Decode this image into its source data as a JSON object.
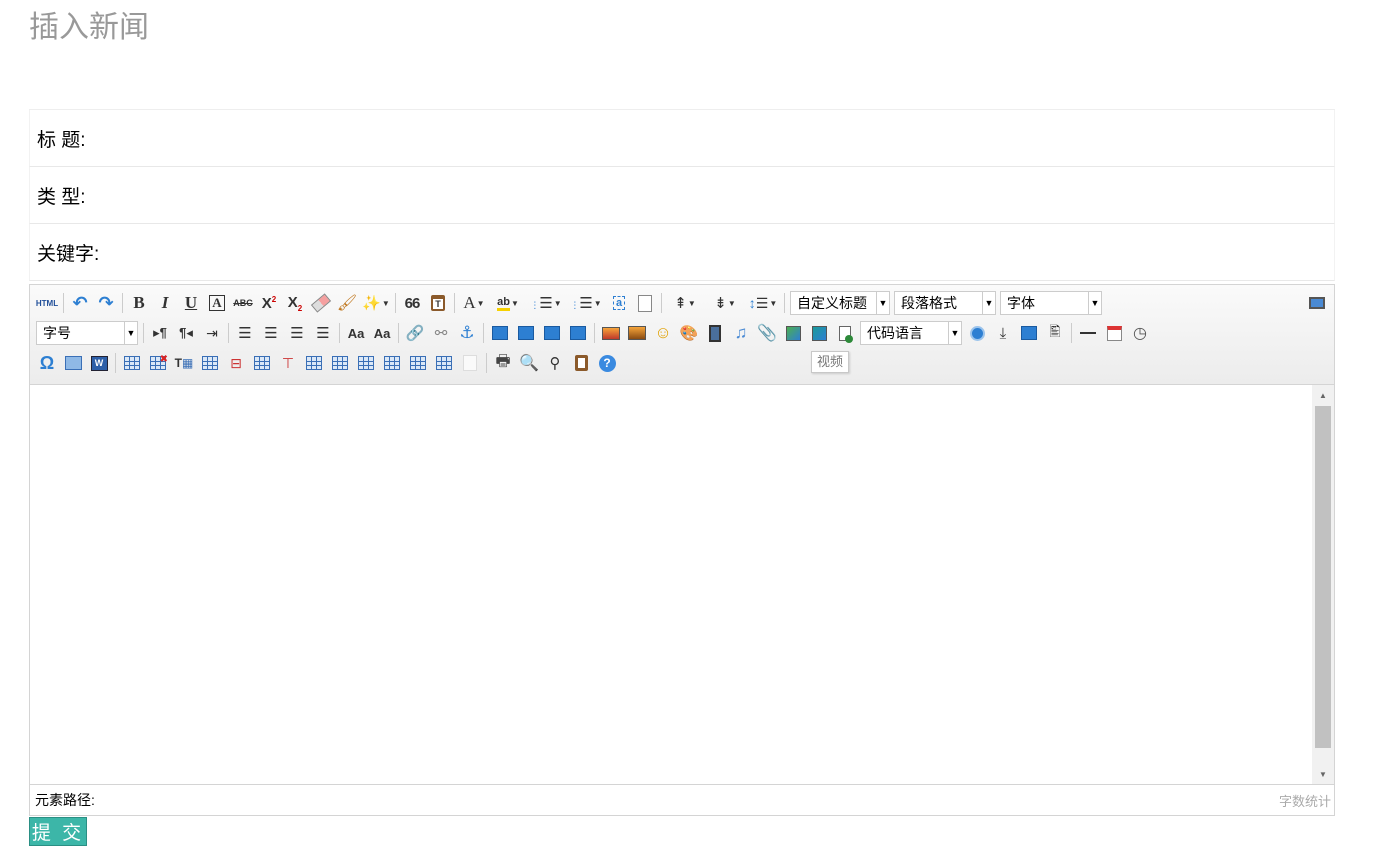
{
  "page": {
    "title": "插入新闻"
  },
  "form": {
    "title_label": "标 题:",
    "type_label": "类 型:",
    "keywords_label": "关键字:"
  },
  "toolbar": {
    "html_label": "HTML",
    "quote_glyph": "66",
    "custom_heading": "自定义标题",
    "paragraph_format": "段落格式",
    "font_family": "字体",
    "font_size": "字号",
    "code_language": "代码语言",
    "tooltip": "视频"
  },
  "statusbar": {
    "element_path": "元素路径:",
    "word_count": "字数统计"
  },
  "submit": {
    "label": "提 交"
  },
  "colors": {
    "submit_bg": "#3cb6a8",
    "title_gray": "#999999"
  }
}
